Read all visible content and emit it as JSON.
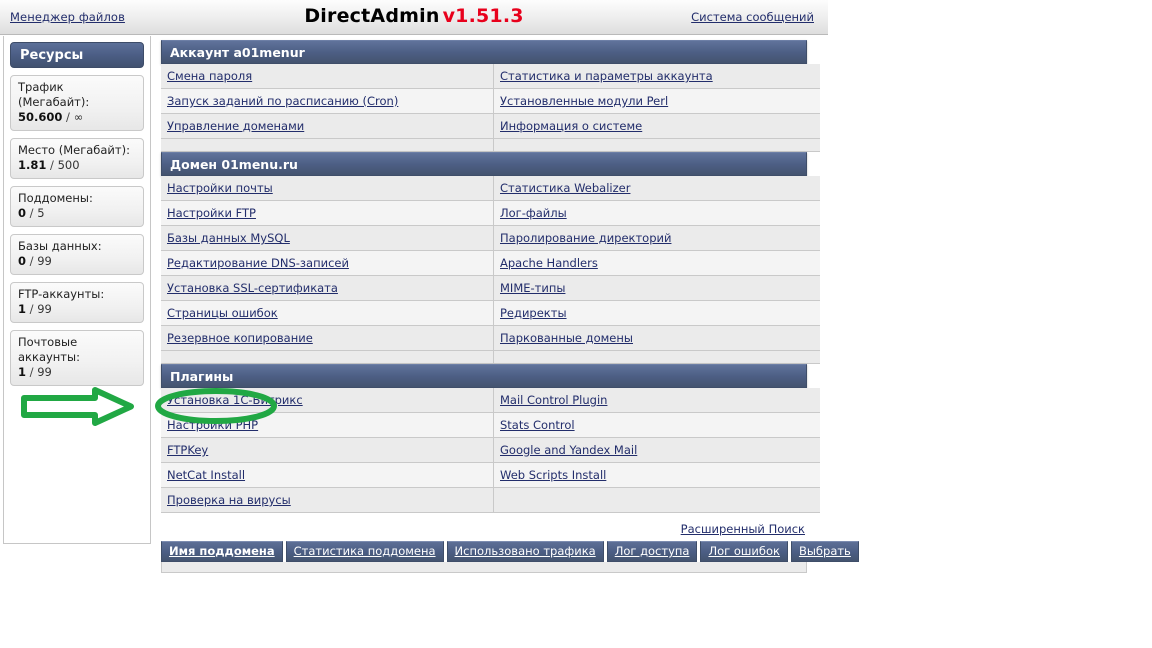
{
  "topbar": {
    "file_manager_label": "Менеджер файлов",
    "brand_name": "DirectAdmin",
    "brand_version": "v1.51.3",
    "messages_label": "Система сообщений",
    "version_color": "#e8001c"
  },
  "sidebar": {
    "title": "Ресурсы",
    "resources": [
      {
        "label": "Трафик (Мегабайт):",
        "used": "50.600",
        "sep": " / ",
        "max": "∞"
      },
      {
        "label": "Место (Мегабайт):",
        "used": "1.81",
        "sep": " / ",
        "max": "500"
      },
      {
        "label": "Поддомены:",
        "used": "0",
        "sep": " / ",
        "max": "5"
      },
      {
        "label": "Базы данных:",
        "used": "0",
        "sep": " / ",
        "max": "99"
      },
      {
        "label": "FTP-аккаунты:",
        "used": "1",
        "sep": " / ",
        "max": "99"
      },
      {
        "label": "Почтовые аккаунты:",
        "used": "1",
        "sep": " / ",
        "max": "99"
      }
    ]
  },
  "sections": [
    {
      "heading": "Аккаунт a01menur",
      "rows": [
        {
          "left": "Смена пароля",
          "right": "Статистика и параметры аккаунта"
        },
        {
          "left": "Запуск заданий по расписанию (Cron)",
          "right": "Установленные модули Perl"
        },
        {
          "left": "Управление доменами",
          "right": "Информация о системе"
        }
      ]
    },
    {
      "heading": "Домен 01menu.ru",
      "rows": [
        {
          "left": "Настройки почты",
          "right": "Статистика Webalizer"
        },
        {
          "left": "Настройки FTP",
          "right": "Лог-файлы"
        },
        {
          "left": "Базы данных MySQL",
          "right": "Паролирование директорий"
        },
        {
          "left": "Редактирование DNS-записей",
          "right": "Apache Handlers"
        },
        {
          "left": "Установка SSL-сертификата",
          "right": "MIME-типы"
        },
        {
          "left": "Страницы ошибок",
          "right": "Редиректы"
        },
        {
          "left": "Резервное копирование",
          "right": "Паркованные домены"
        }
      ]
    },
    {
      "heading": "Плагины",
      "rows": [
        {
          "left": "Установка 1С-Битрикс",
          "right": "Mail Control Plugin"
        },
        {
          "left": "Настройки PHP",
          "right": "Stats Control"
        },
        {
          "left": "FTPKey",
          "right": "Google and Yandex Mail"
        },
        {
          "left": "NetCat Install",
          "right": "Web Scripts Install"
        },
        {
          "left": "Проверка на вирусы",
          "right": ""
        }
      ]
    }
  ],
  "footer": {
    "advanced_search_label": "Расширенный Поиск",
    "buttons": [
      {
        "label": "Имя поддомена",
        "active": true
      },
      {
        "label": "Статистика поддомена",
        "active": false
      },
      {
        "label": "Использовано трафика",
        "active": false
      },
      {
        "label": "Лог доступа",
        "active": false
      },
      {
        "label": "Лог ошибок",
        "active": false
      },
      {
        "label": "Выбрать",
        "active": false
      }
    ]
  },
  "annotation": {
    "color": "#21a844",
    "target_label": "Настройки PHP",
    "shape": "arrow-and-ellipse"
  }
}
